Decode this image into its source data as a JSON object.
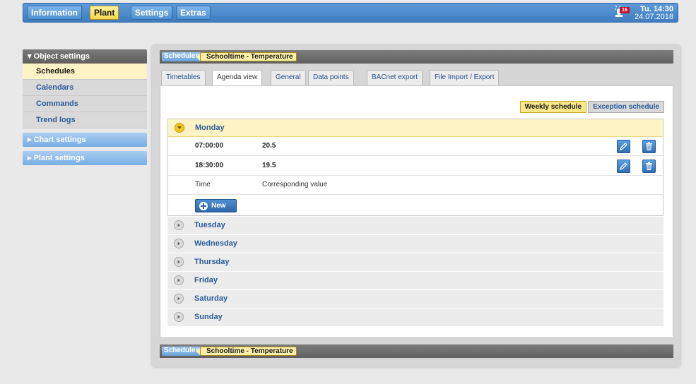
{
  "topbar": {
    "menu": [
      "Information",
      "Plant",
      "Settings",
      "Extras"
    ],
    "active_menu": "Plant",
    "alarm_count": "16",
    "clock_time": "Tu. 14:30",
    "clock_date": "24.07.2018"
  },
  "sidebar": {
    "object_settings": "▾ Object settings",
    "items": [
      "Schedules",
      "Calendars",
      "Commands",
      "Trend logs"
    ],
    "active_item": "Schedules",
    "chart_settings": "▸ Chart settings",
    "plant_settings": "▸ Plant settings"
  },
  "breadcrumb": {
    "section": "Schedules",
    "object": "Schooltime - Temperature"
  },
  "tabs": [
    "Timetables",
    "Agenda view",
    "General",
    "Data points",
    "BACnet export",
    "File Import / Export"
  ],
  "active_tab": "Agenda view",
  "schedule_switch": {
    "weekly": "Weekly schedule",
    "exception": "Exception schedule"
  },
  "open_day": {
    "name": "Monday",
    "entries": [
      {
        "time": "07:00:00",
        "value": "20.5"
      },
      {
        "time": "18:30:00",
        "value": "19.5"
      }
    ],
    "col_time": "Time",
    "col_value": "Corresponding value",
    "new_label": "New"
  },
  "closed_days": [
    "Tuesday",
    "Wednesday",
    "Thursday",
    "Friday",
    "Saturday",
    "Sunday"
  ],
  "colors": {
    "accent_blue": "#3f7dc0",
    "highlight_yellow": "#fdf3c4",
    "link_blue": "#2a5c9c"
  }
}
